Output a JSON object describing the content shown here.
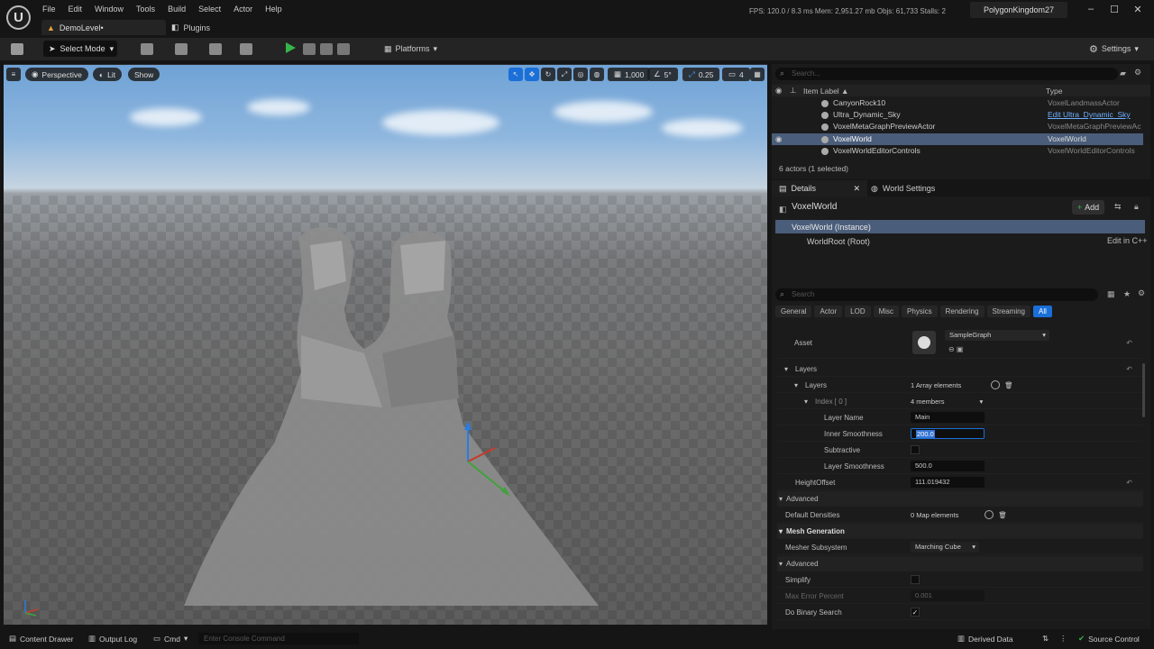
{
  "app": {
    "logo": "U",
    "menu": [
      "File",
      "Edit",
      "Window",
      "Tools",
      "Build",
      "Select",
      "Actor",
      "Help"
    ],
    "tabs": {
      "level": "DemoLevel•",
      "plugins": "Plugins"
    },
    "stats": "FPS: 120.0  /  8.3 ms   Mem: 2,951.27 mb   Objs: 61,733   Stalls: 2",
    "project": "PolygonKingdom27"
  },
  "toolbar": {
    "select_mode": "Select Mode",
    "platforms": "Platforms",
    "settings": "Settings"
  },
  "viewport": {
    "perspective": "Perspective",
    "lit": "Lit",
    "show": "Show",
    "grid_size": "1,000",
    "angle": "5°",
    "scale": "0.25",
    "cam_speed": "4"
  },
  "outliner": {
    "search_placeholder": "Search...",
    "col_label": "Item Label ▲",
    "col_type": "Type",
    "rows": [
      {
        "label": "CanyonRock10",
        "type": "VoxelLandmassActor"
      },
      {
        "label": "Ultra_Dynamic_Sky",
        "type": "Edit Ultra_Dynamic_Sky"
      },
      {
        "label": "VoxelMetaGraphPreviewActor",
        "type": "VoxelMetaGraphPreviewActor"
      },
      {
        "label": "VoxelWorld",
        "type": "VoxelWorld"
      },
      {
        "label": "VoxelWorldEditorControls",
        "type": "VoxelWorldEditorControls"
      }
    ],
    "count": "6 actors (1 selected)"
  },
  "details": {
    "tab_details": "Details",
    "tab_world": "World Settings",
    "actor_name": "VoxelWorld",
    "add_label": "Add",
    "component_instance": "VoxelWorld (Instance)",
    "component_root": "WorldRoot (Root)",
    "edit_cpp": "Edit in C++",
    "search_placeholder": "Search",
    "filters": [
      "General",
      "Actor",
      "LOD",
      "Misc",
      "Physics",
      "Rendering",
      "Streaming",
      "All"
    ],
    "props": {
      "asset_label": "Asset",
      "asset_value": "SampleGraph",
      "layers_label": "Layers",
      "layers_inner_label": "Layers",
      "layers_inner_value": "1 Array elements",
      "index_label": "Index [ 0 ]",
      "index_value": "4 members",
      "layer_name_label": "Layer Name",
      "layer_name_value": "Main",
      "inner_smooth_label": "Inner Smoothness",
      "inner_smooth_value": "200.0",
      "subtractive_label": "Subtractive",
      "layer_smooth_label": "Layer Smoothness",
      "layer_smooth_value": "500.0",
      "height_label": "HeightOffset",
      "height_value": "111.019432",
      "advanced1": "Advanced",
      "densities_label": "Default Densities",
      "densities_value": "0 Map elements",
      "mesh_gen": "Mesh Generation",
      "mesher_label": "Mesher Subsystem",
      "mesher_value": "Marching Cube",
      "advanced2": "Advanced",
      "simplify_label": "Simplify",
      "max_err_label": "Max Error Percent",
      "max_err_value": "0.001",
      "binary_label": "Do Binary Search"
    }
  },
  "status": {
    "content_drawer": "Content Drawer",
    "output_log": "Output Log",
    "cmd": "Cmd",
    "console_placeholder": "Enter Console Command",
    "derived_data": "Derived Data",
    "source_control": "Source Control"
  },
  "colors": {
    "accent": "#1a6fd8",
    "selection": "#4a5d7a",
    "play": "#35b54a"
  }
}
